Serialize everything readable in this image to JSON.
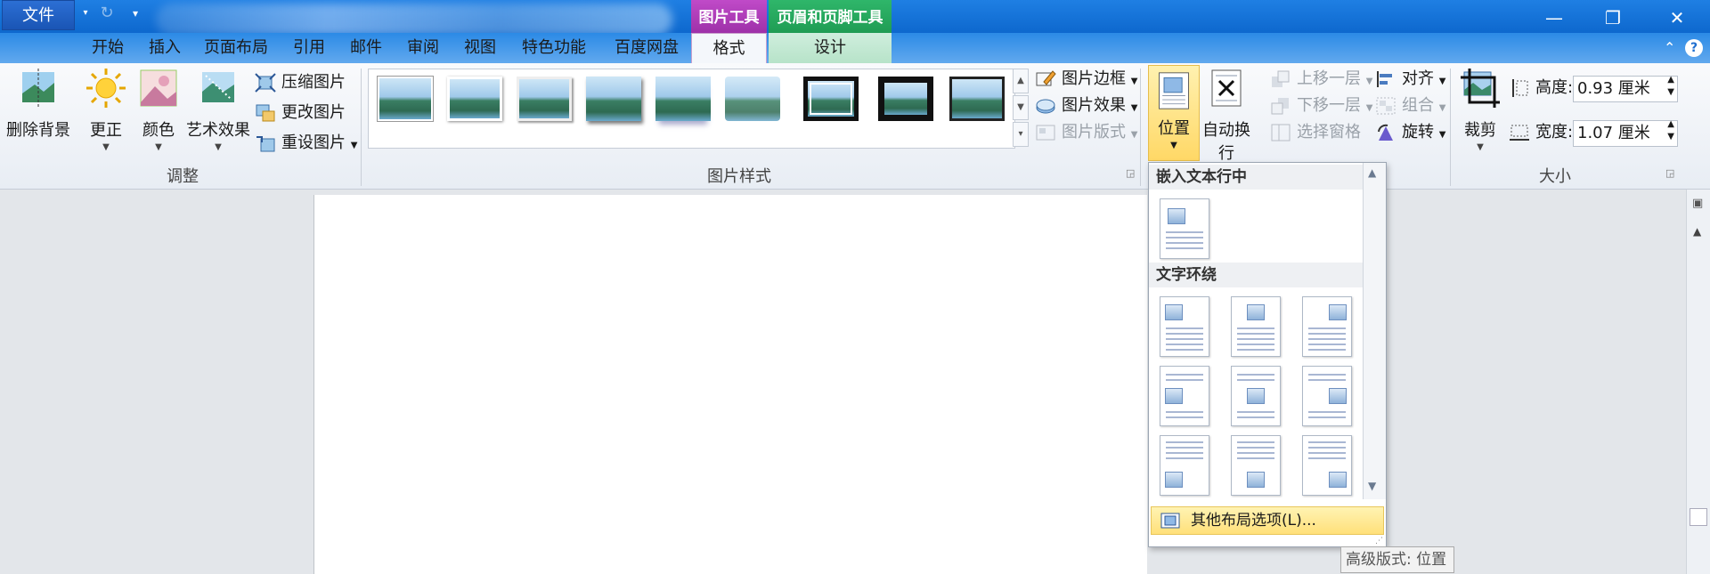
{
  "title_bar": {
    "context_picture_tools": "图片工具",
    "context_header_footer_tools": "页眉和页脚工具"
  },
  "tabs": {
    "file": "文件",
    "home": "开始",
    "insert": "插入",
    "page_layout": "页面布局",
    "references": "引用",
    "mailings": "邮件",
    "review": "审阅",
    "view": "视图",
    "special": "特色功能",
    "baidu": "百度网盘",
    "format": "格式",
    "design": "设计"
  },
  "ribbon": {
    "adjust": {
      "label": "调整",
      "remove_bg": "删除背景",
      "corrections": "更正",
      "color": "颜色",
      "artistic": "艺术效果",
      "compress": "压缩图片",
      "change": "更改图片",
      "reset": "重设图片"
    },
    "styles": {
      "label": "图片样式",
      "border": "图片边框",
      "effects": "图片效果",
      "layout": "图片版式"
    },
    "arrange": {
      "position": "位置",
      "wrap": "自动换行",
      "bring_forward": "上移一层",
      "send_backward": "下移一层",
      "selection_pane": "选择窗格",
      "align": "对齐",
      "group": "组合",
      "rotate": "旋转"
    },
    "size": {
      "label": "大小",
      "crop": "裁剪",
      "height_label": "高度:",
      "height_value": "0.93 厘米",
      "width_label": "宽度:",
      "width_value": "1.07 厘米"
    }
  },
  "position_dropdown": {
    "inline_header": "嵌入文本行中",
    "wrap_header": "文字环绕",
    "more_options": "其他布局选项(L)..."
  },
  "tooltip": "高级版式: 位置"
}
